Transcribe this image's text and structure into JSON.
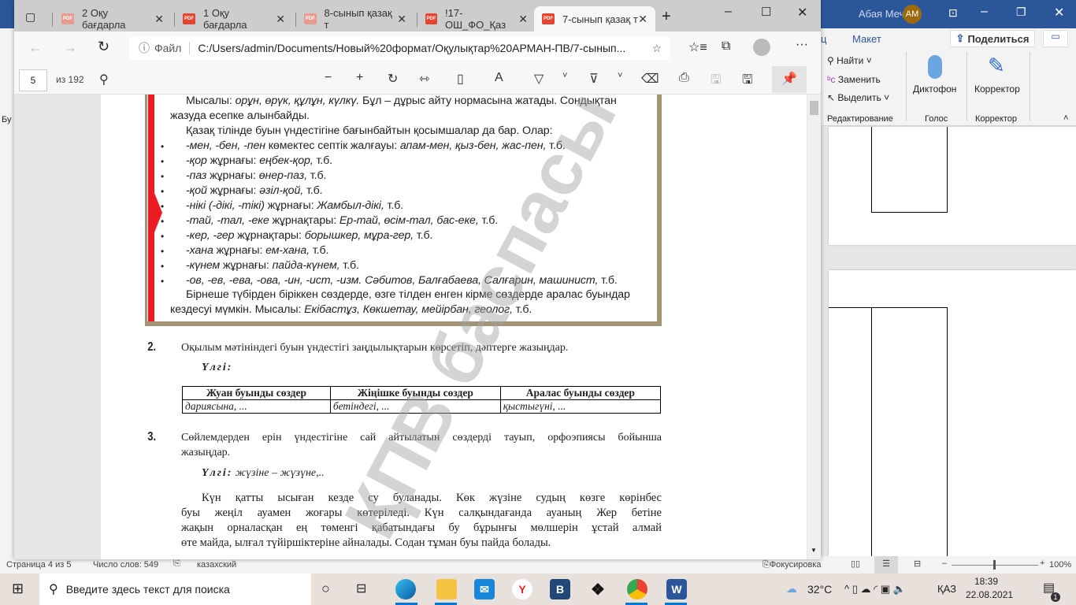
{
  "word": {
    "user": "Абая Мечта",
    "initials": "AM",
    "tab_partial": "ц",
    "tab_layout": "Макет",
    "share": "Поделиться",
    "edit_group": {
      "find": "Найти",
      "replace": "Заменить",
      "select": "Выделить",
      "label": "Редактирование"
    },
    "voice": {
      "dictate": "Диктофон",
      "label": "Голос"
    },
    "editor": {
      "btn": "Корректор",
      "label": "Корректор"
    },
    "left_partial": "Бу",
    "status": {
      "page": "Страница 4 из 5",
      "words": "Число слов: 549",
      "lang": "казахский",
      "focus": "Фокусировка",
      "zoom": "100%"
    }
  },
  "taskbar": {
    "search_placeholder": "Введите здесь текст для поиска",
    "weather": "32°C",
    "lang": "ҚАЗ",
    "time": "18:39",
    "date": "22.08.2021",
    "notif_count": "1",
    "accent": "#0078d7"
  },
  "browser": {
    "tabs": [
      {
        "title": "2 Оқу бағдарла"
      },
      {
        "title": "1 Оқу бағдарла"
      },
      {
        "title": "8-сынып қазақ т"
      },
      {
        "title": "!17-ОШ_ФО_Қаз"
      },
      {
        "title": "7-сынып қазақ т"
      }
    ],
    "file_label": "Файл",
    "url": "C:/Users/admin/Documents/Новый%20формат/Оқулықтар%20АРМАН-ПВ/7-сынып...",
    "pdf": {
      "page": "5",
      "of": "из 192"
    }
  },
  "doc": {
    "box_lines": [
      {
        "t": "Мысалы: ",
        "i": "орұн, өрүк, құлұн, күлкү.",
        "r": " Бұл – дұрыс айту нормасына жатады. Сондықтан"
      },
      {
        "t": "жазуда есепке алынбайды."
      },
      {
        "t": "Қазақ тілінде буын үндестігіне бағынбайтын қосымшалар да бар. Олар:"
      }
    ],
    "bullets": [
      {
        "i": "-мен, -бен, -пен",
        "r": " көмектес септік жалғауы: ",
        "i2": "апам-мен, қыз-бен, жас-пен,",
        "e": " т.б."
      },
      {
        "i": "-қор",
        "r": " жұрнағы: ",
        "i2": "еңбек-қор,",
        "e": " т.б."
      },
      {
        "i": "-паз",
        "r": " жұрнағы: ",
        "i2": "өнер-паз,",
        "e": " т.б."
      },
      {
        "i": "-қой",
        "r": " жұрнағы: ",
        "i2": "әзіл-қой,",
        "e": " т.б."
      },
      {
        "i": "-нікі (-дікі, -тікі)",
        "r": " жұрнағы: ",
        "i2": "Жамбыл-дікі,",
        "e": " т.б."
      },
      {
        "i": "-тай, -тал, -еке",
        "r": " жұрнақтары: ",
        "i2": "Ер-тай, өсім-тал, бас-еке,",
        "e": " т.б."
      },
      {
        "i": "-кер, -гер",
        "r": " жұрнақтары: ",
        "i2": "борышкер, мұра-гер,",
        "e": " т.б."
      },
      {
        "i": "-хана",
        "r": " жұрнағы: ",
        "i2": "ем-хана,",
        "e": " т.б."
      },
      {
        "i": "-күнем",
        "r": " жұрнағы: ",
        "i2": "пайда-күнем,",
        "e": " т.б."
      },
      {
        "i": "-ов, -ев, -ева, -ова, -ин, -ист, -изм.",
        "r": " ",
        "i2": "Сәбитов, Балғабаева, Салғарин, машинист,",
        "e": " т.б."
      }
    ],
    "closing1": "Бірнеше түбірден біріккен сөздерде, өзге тілден енген кірме сөздерде аралас буындар",
    "closing2a": "кездесуі мүмкін. Мысалы: ",
    "closing2i": "Екібастұз, Көкшетау, мейірбан, геолог,",
    "closing2e": " т.б.",
    "ex2_num": "2.",
    "ex2": "Оқылым мәтініндегі буын үндестігі заңдылықтарын көрсетіп, дәптерге жазыңдар.",
    "sample": "Үлгі:",
    "table": {
      "headers": [
        "Жуан буынды сөздер",
        "Жіңішке буынды сөздер",
        "Аралас буынды сөздер"
      ],
      "row": [
        "дариясына, ...",
        "бетіндегі, ...",
        "қыстыгүні, ..."
      ]
    },
    "ex3_num": "3.",
    "ex3a": "Сөйлемдерден ерін үндестігіне сай айтылатын сөздерді тауып, орфоэпиясы бойынша",
    "ex3b": "жазыңдар.",
    "sample3": "жүзіне – жүзүне,..",
    "para": [
      "Күн қатты ысыған кезде су буланады. Көк жүзіне судың көзге көрінбес",
      "буы жеңіл ауамен жоғары көтеріледі. Күн салқындағанда ауаның Жер бетіне",
      "жақын орналасқан ең төменгі қабатындағы бу бұрынғы мөлшерін ұстай алмай",
      "өте майда, ылғал түйіршіктеріне айналады. Содан тұман буы пайда болады."
    ],
    "watermark": "ҚПВ баспасы"
  }
}
